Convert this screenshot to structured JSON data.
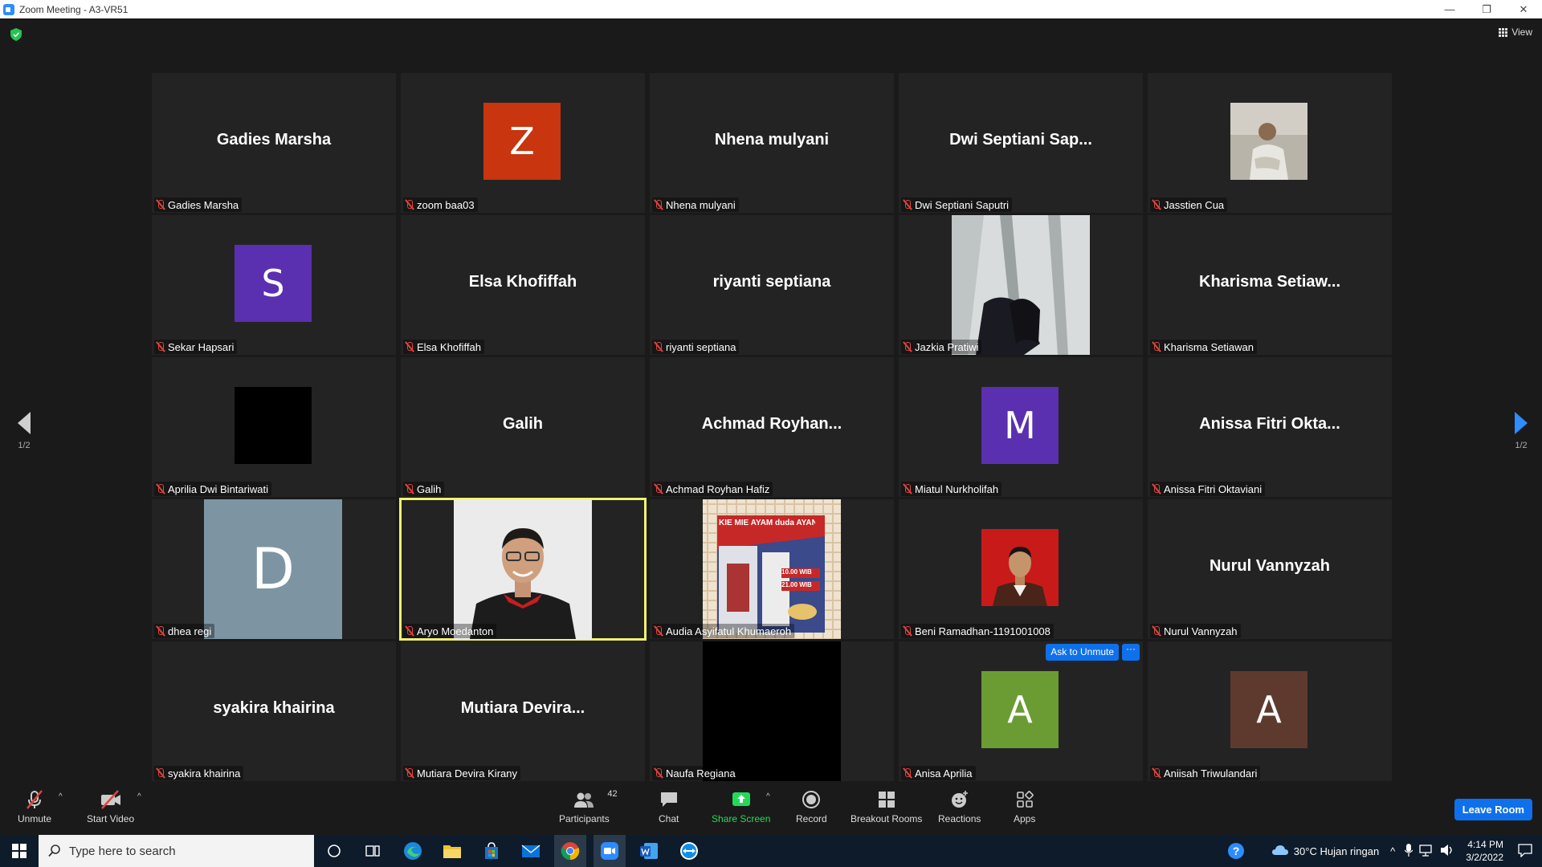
{
  "window": {
    "title": "Zoom Meeting - A3-VR51"
  },
  "header": {
    "view_label": "View"
  },
  "pager": {
    "left": "1/2",
    "right": "1/2"
  },
  "tiles": [
    {
      "name": "Gadies Marsha",
      "big": "Gadies Marsha"
    },
    {
      "name": "zoom baa03",
      "initial": "Z",
      "color": "#c8350f"
    },
    {
      "name": "Nhena mulyani",
      "big": "Nhena mulyani"
    },
    {
      "name": "Dwi Septiani Saputri",
      "big": "Dwi Septiani Sap..."
    },
    {
      "name": "Jasstien Cua"
    },
    {
      "name": "Sekar Hapsari",
      "initial": "S",
      "color": "#5a2fb0"
    },
    {
      "name": "Elsa Khofiffah",
      "big": "Elsa Khofiffah"
    },
    {
      "name": "riyanti septiana",
      "big": "riyanti septiana"
    },
    {
      "name": "Jazkia Pratiwi"
    },
    {
      "name": "Kharisma Setiawan",
      "big": "Kharisma  Setiaw..."
    },
    {
      "name": "Aprilia Dwi Bintariwati"
    },
    {
      "name": "Galih",
      "big": "Galih"
    },
    {
      "name": "Achmad Royhan Hafiz",
      "big": "Achmad  Royhan..."
    },
    {
      "name": "Miatul Nurkholifah",
      "initial": "M",
      "color": "#5a2fb0"
    },
    {
      "name": "Anissa Fitri Oktaviani",
      "big": "Anissa  Fitri  Okta..."
    },
    {
      "name": "dhea regi",
      "initial": "D",
      "color": "#7d95a3"
    },
    {
      "name": "Aryo Moedanton"
    },
    {
      "name": "Audia Asyifatul Khumaeroh",
      "poster_title": "KIE MIE AYAM duda AYANG",
      "poster_time1": "10.00 WIB",
      "poster_time2": "21.00 WIB"
    },
    {
      "name": "Beni Ramadhan-1191001008"
    },
    {
      "name": "Nurul Vannyzah",
      "big": "Nurul Vannyzah"
    },
    {
      "name": "syakira khairina",
      "big": "syakira khairina"
    },
    {
      "name": "Mutiara Devira Kirany",
      "big": "Mutiara  Devira..."
    },
    {
      "name": "Naufa Regiana"
    },
    {
      "name": "Anisa Aprilia",
      "initial": "A",
      "color": "#6a9c33",
      "ask_label": "Ask to Unmute",
      "more_label": "···"
    },
    {
      "name": "Aniisah Triwulandari",
      "initial": "A",
      "color": "#5e3a2e"
    }
  ],
  "toolbar": {
    "unmute": "Unmute",
    "start_video": "Start Video",
    "participants": "Participants",
    "participants_count": "42",
    "chat": "Chat",
    "share_screen": "Share Screen",
    "record": "Record",
    "breakout_rooms": "Breakout Rooms",
    "reactions": "Reactions",
    "apps": "Apps",
    "leave": "Leave Room"
  },
  "taskbar": {
    "search_placeholder": "Type here to search",
    "weather": "30°C  Hujan ringan",
    "time": "4:14 PM",
    "date": "3/2/2022"
  },
  "colors": {
    "accent": "#0e71eb",
    "muted": "#e0443e",
    "share": "#23d959",
    "selected": "#f2f26e"
  }
}
